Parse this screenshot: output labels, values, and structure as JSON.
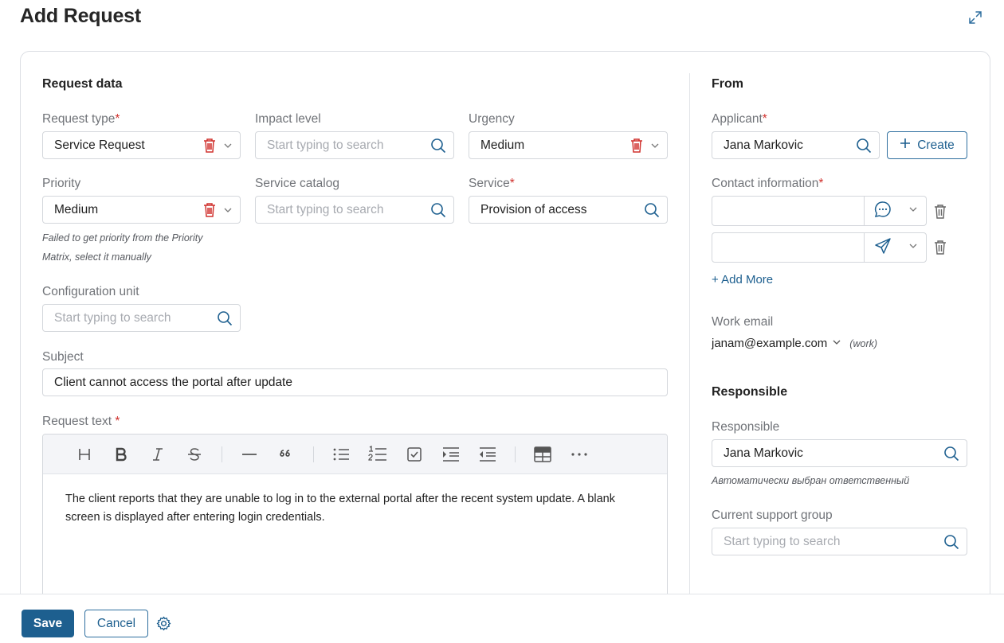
{
  "page": {
    "title": "Add Request"
  },
  "request_data": {
    "section_title": "Request data",
    "request_type": {
      "label": "Request type",
      "value": "Service Request"
    },
    "impact_level": {
      "label": "Impact level",
      "placeholder": "Start typing to search"
    },
    "urgency": {
      "label": "Urgency",
      "value": "Medium"
    },
    "priority": {
      "label": "Priority",
      "value": "Medium",
      "hint_line1": "Failed to get priority from the Priority",
      "hint_line2": "Matrix, select it manually"
    },
    "service_catalog": {
      "label": "Service catalog",
      "placeholder": "Start typing to search"
    },
    "service": {
      "label": "Service",
      "value": "Provision of access"
    },
    "configuration_unit": {
      "label": "Configuration unit",
      "placeholder": "Start typing to search"
    },
    "subject": {
      "label": "Subject",
      "value": "Client cannot access the portal after update"
    },
    "request_text": {
      "label": "Request text",
      "line1": "The client reports that they are unable to log in to the external portal after the recent system update. A blank",
      "line2": "screen is displayed after entering login credentials."
    }
  },
  "from": {
    "section_title": "From",
    "applicant": {
      "label": "Applicant",
      "value": "Jana Markovic"
    },
    "create_label": "Create",
    "contact_information": {
      "label": "Contact information"
    },
    "add_more_label": "+ Add More",
    "work_email": {
      "label": "Work email",
      "value": "janam@example.com",
      "tag": "(work)"
    }
  },
  "responsible_section": {
    "section_title": "Responsible",
    "responsible": {
      "label": "Responsible",
      "value": "Jana Markovic",
      "hint": "Автоматически выбран ответственный"
    },
    "support_group": {
      "label": "Current support group",
      "placeholder": "Start typing to search"
    }
  },
  "footer": {
    "save_label": "Save",
    "cancel_label": "Cancel"
  },
  "colors": {
    "accent": "#1d5f8f",
    "required": "#d0312d",
    "trash": "#d0312d"
  }
}
